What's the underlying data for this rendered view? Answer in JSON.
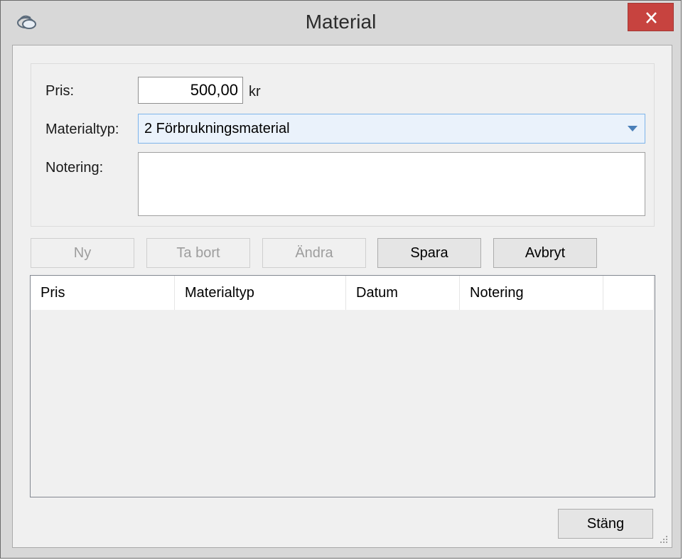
{
  "window": {
    "title": "Material",
    "icon": "app-icon",
    "close_icon": "close-icon"
  },
  "form": {
    "price_label": "Pris:",
    "price_value": "500,00",
    "price_unit": "kr",
    "type_label": "Materialtyp:",
    "type_value": "2 Förbrukningsmaterial",
    "note_label": "Notering:",
    "note_value": ""
  },
  "buttons": {
    "new": "Ny",
    "delete": "Ta bort",
    "edit": "Ändra",
    "save": "Spara",
    "cancel": "Avbryt",
    "close": "Stäng"
  },
  "table": {
    "columns": [
      "Pris",
      "Materialtyp",
      "Datum",
      "Notering"
    ],
    "rows": []
  },
  "colors": {
    "close_button": "#c7433f",
    "combo_highlight": "#eaf2fb",
    "combo_border": "#7eb4ea"
  }
}
